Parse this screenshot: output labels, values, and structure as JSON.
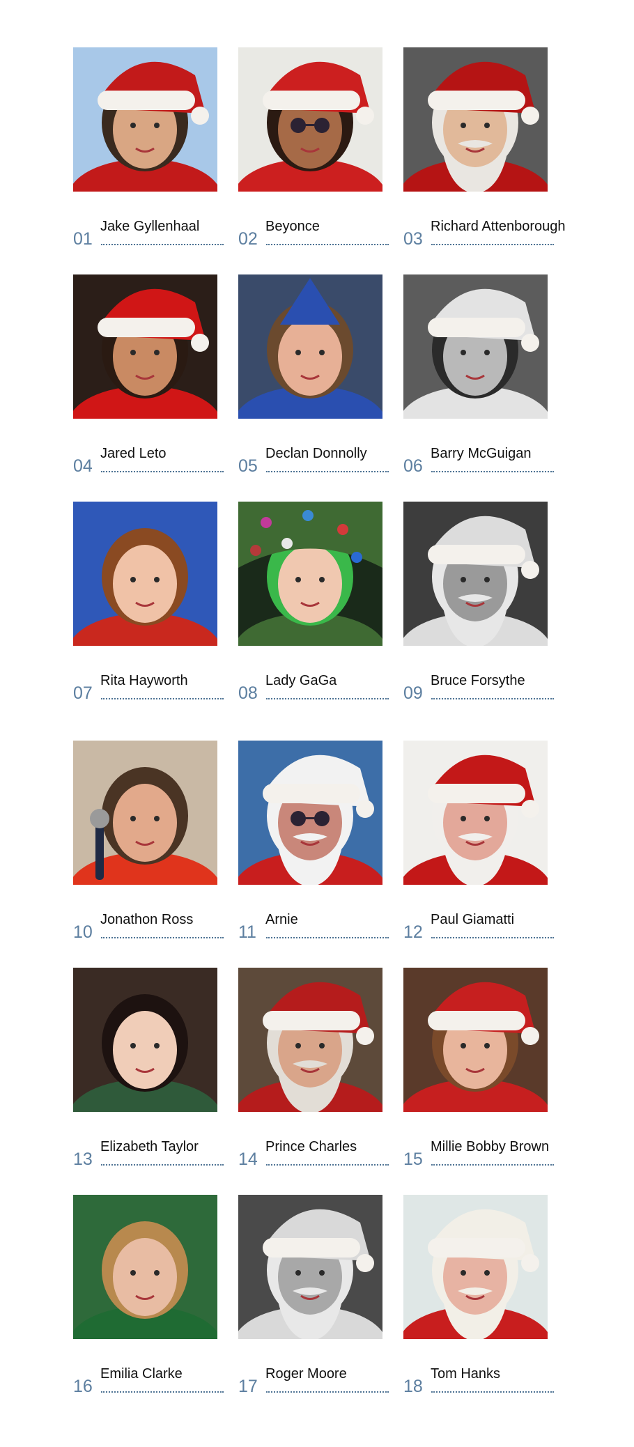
{
  "entries": [
    {
      "num": "01",
      "name": "Jake Gyllenhaal",
      "photo_icon": "person-santa-hat-icon",
      "bg": "#a8c8e8",
      "skin": "#d9a683",
      "hair": "#3a2a1e",
      "hat": "#c21a1a"
    },
    {
      "num": "02",
      "name": "Beyonce",
      "photo_icon": "person-santa-hat-glasses-icon",
      "bg": "#e9e9e4",
      "skin": "#a66a47",
      "hair": "#2b1a12",
      "hat": "#cc1f1f"
    },
    {
      "num": "03",
      "name": "Richard Attenborough",
      "photo_icon": "santa-face-icon",
      "bg": "#5a5a5a",
      "skin": "#e1b99a",
      "hair": "#e9e6e1",
      "hat": "#b51414"
    },
    {
      "num": "04",
      "name": "Jared Leto",
      "photo_icon": "person-santa-hat-icon",
      "bg": "#2b1e18",
      "skin": "#c98a63",
      "hair": "#2a1a12",
      "hat": "#d01616"
    },
    {
      "num": "05",
      "name": "Declan Donnolly",
      "photo_icon": "person-elf-hat-icon",
      "bg": "#3a4b6a",
      "skin": "#e7b096",
      "hair": "#6b4a2e",
      "hat": "#2a4fb0"
    },
    {
      "num": "06",
      "name": "Barry McGuigan",
      "photo_icon": "person-santa-hat-icon",
      "bg": "#5c5c5c",
      "skin": "#b9b9b9",
      "hair": "#2a2a2a",
      "hat": "#e3e3e3"
    },
    {
      "num": "07",
      "name": "Rita Hayworth",
      "photo_icon": "person-portrait-icon",
      "bg": "#2f58b8",
      "skin": "#f0c2a7",
      "hair": "#8a4a22",
      "hat": "#c9281e"
    },
    {
      "num": "08",
      "name": "Lady GaGa",
      "photo_icon": "person-christmas-tree-hat-icon",
      "bg": "#1a2a1a",
      "skin": "#f0c8b0",
      "hair": "#3ab84a",
      "hat": "#3f6a33"
    },
    {
      "num": "09",
      "name": "Bruce Forsythe",
      "photo_icon": "santa-face-icon",
      "bg": "#3d3d3d",
      "skin": "#9a9a9a",
      "hair": "#e7e7e7",
      "hat": "#dcdcdc"
    },
    {
      "num": "10",
      "name": "Jonathon Ross",
      "photo_icon": "person-microphone-icon",
      "bg": "#c9b9a5",
      "skin": "#e2a98b",
      "hair": "#4a3424",
      "hat": "#e0341c"
    },
    {
      "num": "11",
      "name": "Arnie",
      "photo_icon": "santa-sunglasses-icon",
      "bg": "#3d6ea8",
      "skin": "#c9877a",
      "hair": "#f2f2f2",
      "hat": "#f2f2f2"
    },
    {
      "num": "12",
      "name": "Paul Giamatti",
      "photo_icon": "santa-face-icon",
      "bg": "#f0efec",
      "skin": "#e3a89a",
      "hair": "#f1efec",
      "hat": "#c31818"
    },
    {
      "num": "13",
      "name": "Elizabeth Taylor",
      "photo_icon": "person-portrait-icon",
      "bg": "#3a2b24",
      "skin": "#f0cdb8",
      "hair": "#1d1210",
      "hat": "#2f5a3a"
    },
    {
      "num": "14",
      "name": "Prince Charles",
      "photo_icon": "santa-face-icon",
      "bg": "#5d4a3a",
      "skin": "#d9a58a",
      "hair": "#e2ddd6",
      "hat": "#b51c1c"
    },
    {
      "num": "15",
      "name": "Millie Bobby Brown",
      "photo_icon": "person-santa-hat-icon",
      "bg": "#5a3a2a",
      "skin": "#e8b59c",
      "hair": "#7a4a2a",
      "hat": "#c61f1f"
    },
    {
      "num": "16",
      "name": "Emilia Clarke",
      "photo_icon": "person-portrait-icon",
      "bg": "#2e6a3a",
      "skin": "#e8bca3",
      "hair": "#b8894e",
      "hat": "#1f6b33"
    },
    {
      "num": "17",
      "name": "Roger Moore",
      "photo_icon": "santa-face-icon",
      "bg": "#4a4a4a",
      "skin": "#a8a8a8",
      "hair": "#e8e8e8",
      "hat": "#d9d9d9"
    },
    {
      "num": "18",
      "name": "Tom Hanks",
      "photo_icon": "santa-face-icon",
      "bg": "#dfe7e6",
      "skin": "#e7b3a3",
      "hair": "#f2efe7",
      "hat": "#f2efe7"
    }
  ]
}
